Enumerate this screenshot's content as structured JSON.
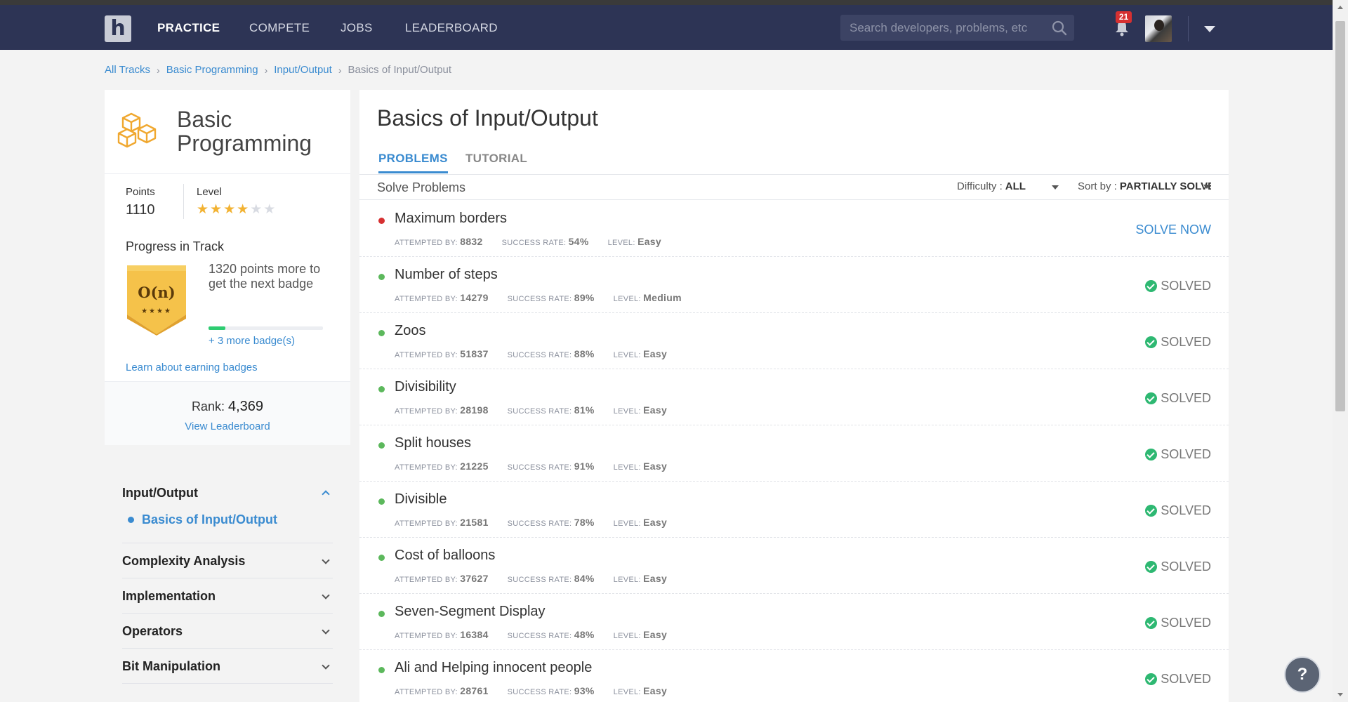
{
  "nav": {
    "logo": "h",
    "items": [
      "PRACTICE",
      "COMPETE",
      "JOBS",
      "LEADERBOARD"
    ],
    "active": "PRACTICE",
    "search_placeholder": "Search developers, problems, etc",
    "notifications": "21"
  },
  "breadcrumb": [
    "All Tracks",
    "Basic Programming",
    "Input/Output",
    "Basics of Input/Output"
  ],
  "track": {
    "title_line1": "Basic",
    "title_line2": "Programming",
    "points_label": "Points",
    "points": "1110",
    "level_label": "Level",
    "level_stars": 4,
    "level_max": 6,
    "progress_title": "Progress in Track",
    "badge_label": "O(n)",
    "badge_stars": "★★★★",
    "progress_text": "1320 points more to get the next badge",
    "progress_fraction": 0.15,
    "more_badges": "+ 3 more badge(s)",
    "learn_link": "Learn about earning badges",
    "rank_label": "Rank:",
    "rank": "4,369",
    "leaderboard_link": "View Leaderboard"
  },
  "topics": [
    {
      "name": "Input/Output",
      "open": true,
      "sub": "Basics of Input/Output"
    },
    {
      "name": "Complexity Analysis",
      "open": false
    },
    {
      "name": "Implementation",
      "open": false
    },
    {
      "name": "Operators",
      "open": false
    },
    {
      "name": "Bit Manipulation",
      "open": false
    }
  ],
  "main": {
    "title": "Basics of Input/Output",
    "tabs": [
      "PROBLEMS",
      "TUTORIAL"
    ],
    "solve_label": "Solve Problems",
    "difficulty_label": "Difficulty :",
    "difficulty_value": "ALL",
    "sort_label": "Sort by :",
    "sort_value": "PARTIALLY SOLVED",
    "meta_labels": {
      "attempted": "ATTEMPTED BY:",
      "success": "SUCCESS RATE:",
      "level": "LEVEL:"
    },
    "status_colors": {
      "unsolved": "#d63031",
      "solved": "#5cb85c"
    }
  },
  "problems": [
    {
      "title": "Maximum borders",
      "attempted": "8832",
      "success": "54%",
      "level": "Easy",
      "status": "SOLVE NOW",
      "solved": false
    },
    {
      "title": "Number of steps",
      "attempted": "14279",
      "success": "89%",
      "level": "Medium",
      "status": "SOLVED",
      "solved": true
    },
    {
      "title": "Zoos",
      "attempted": "51837",
      "success": "88%",
      "level": "Easy",
      "status": "SOLVED",
      "solved": true
    },
    {
      "title": "Divisibility",
      "attempted": "28198",
      "success": "81%",
      "level": "Easy",
      "status": "SOLVED",
      "solved": true
    },
    {
      "title": "Split houses",
      "attempted": "21225",
      "success": "91%",
      "level": "Easy",
      "status": "SOLVED",
      "solved": true
    },
    {
      "title": "Divisible",
      "attempted": "21581",
      "success": "78%",
      "level": "Easy",
      "status": "SOLVED",
      "solved": true
    },
    {
      "title": "Cost of balloons",
      "attempted": "37627",
      "success": "84%",
      "level": "Easy",
      "status": "SOLVED",
      "solved": true
    },
    {
      "title": "Seven-Segment Display",
      "attempted": "16384",
      "success": "48%",
      "level": "Easy",
      "status": "SOLVED",
      "solved": true
    },
    {
      "title": "Ali and Helping innocent people",
      "attempted": "28761",
      "success": "93%",
      "level": "Easy",
      "status": "SOLVED",
      "solved": true
    }
  ],
  "help": "?"
}
